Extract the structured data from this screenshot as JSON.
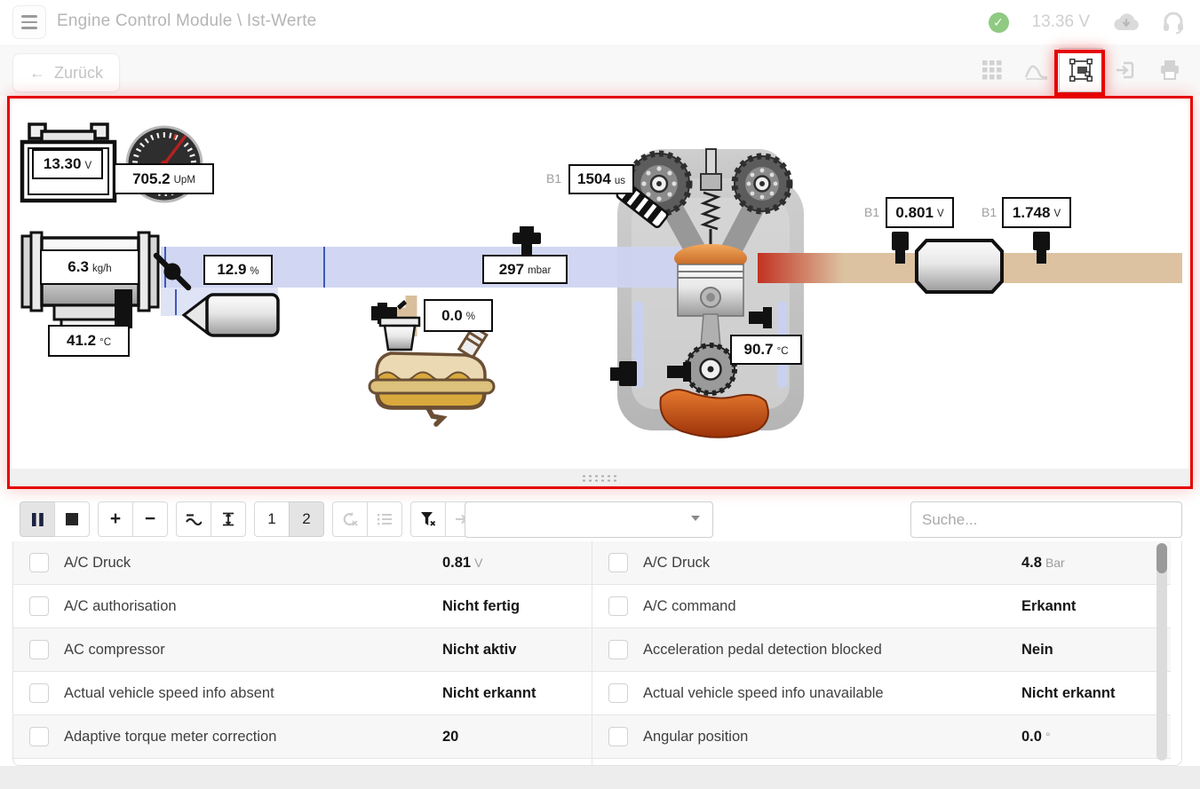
{
  "header": {
    "title": "Engine Control Module \\ Ist-Werte",
    "battery_status": "13.36 V"
  },
  "nav": {
    "back_arrow": "←",
    "back_label": "Zurück"
  },
  "diagram": {
    "battery": {
      "value": "13.30",
      "unit": "V"
    },
    "rpm": {
      "value": "705.2",
      "unit": "UpM"
    },
    "air_mass": {
      "value": "6.3",
      "unit": "kg/h"
    },
    "intake_air_temp": {
      "value": "41.2",
      "unit": "°C"
    },
    "throttle_position": {
      "value": "12.9",
      "unit": "%"
    },
    "manifold_pressure": {
      "value": "297",
      "unit": "mbar"
    },
    "egr_position": {
      "value": "0.0",
      "unit": "%"
    },
    "injection_time": {
      "bank": "B1",
      "value": "1504",
      "unit": "us"
    },
    "coolant_temp": {
      "value": "90.7",
      "unit": "°C"
    },
    "o2_pre_cat": {
      "bank": "B1",
      "value": "0.801",
      "unit": "V"
    },
    "o2_post_cat": {
      "bank": "B1",
      "value": "1.748",
      "unit": "V"
    }
  },
  "list_toolbar": {
    "page_one": "1",
    "page_two": "2",
    "mode_select_value": "",
    "search_placeholder": "Suche..."
  },
  "values_table": {
    "left": [
      {
        "label": "A/C Druck",
        "value": "0.81",
        "unit": "V"
      },
      {
        "label": "A/C authorisation",
        "value": "Nicht fertig",
        "unit": ""
      },
      {
        "label": "AC compressor",
        "value": "Nicht aktiv",
        "unit": ""
      },
      {
        "label": "Actual vehicle speed info absent",
        "value": "Nicht erkannt",
        "unit": ""
      },
      {
        "label": "Adaptive torque meter correction",
        "value": "20",
        "unit": ""
      }
    ],
    "right": [
      {
        "label": "A/C Druck",
        "value": "4.8",
        "unit": "Bar"
      },
      {
        "label": "A/C command",
        "value": "Erkannt",
        "unit": ""
      },
      {
        "label": "Acceleration pedal detection blocked",
        "value": "Nein",
        "unit": ""
      },
      {
        "label": "Actual vehicle speed info unavailable",
        "value": "Nicht erkannt",
        "unit": ""
      },
      {
        "label": "Angular position",
        "value": "0.0",
        "unit": "°"
      }
    ]
  },
  "colors": {
    "annotation_red": "#e60400",
    "intake_pipe_blue": "#cdd4f1",
    "exhaust_pipe_tan": "#dcc2a0",
    "status_green": "#8fca83"
  }
}
